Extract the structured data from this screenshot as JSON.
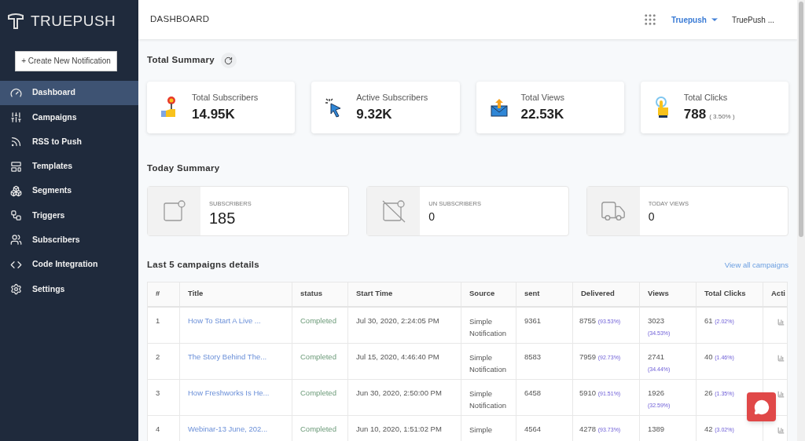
{
  "brand": "TRUEPUSH",
  "create_button": "+ Create New Notification",
  "sidebar": {
    "items": [
      {
        "label": "Dashboard",
        "selected": true
      },
      {
        "label": "Campaigns",
        "selected": false
      },
      {
        "label": "RSS to Push",
        "selected": false
      },
      {
        "label": "Templates",
        "selected": false
      },
      {
        "label": "Segments",
        "selected": false
      },
      {
        "label": "Triggers",
        "selected": false
      },
      {
        "label": "Subscribers",
        "selected": false
      },
      {
        "label": "Code Integration",
        "selected": false
      },
      {
        "label": "Settings",
        "selected": false
      }
    ]
  },
  "header": {
    "title": "DASHBOARD",
    "project": "Truepush",
    "user": "TruePush ..."
  },
  "total_summary": {
    "title": "Total Summary",
    "cards": [
      {
        "label": "Total Subscribers",
        "value": "14.95K"
      },
      {
        "label": "Active Subscribers",
        "value": "9.32K"
      },
      {
        "label": "Total Views",
        "value": "22.53K"
      },
      {
        "label": "Total Clicks",
        "value": "788",
        "note": "( 3.50% )"
      }
    ]
  },
  "today_summary": {
    "title": "Today Summary",
    "cards": [
      {
        "label": "SUBSCRIBERS",
        "value": "185"
      },
      {
        "label": "UN SUBSCRIBERS",
        "value": "0"
      },
      {
        "label": "TODAY VIEWS",
        "value": "0"
      }
    ]
  },
  "campaigns": {
    "title": "Last 5 campaigns details",
    "link": "View all campaigns",
    "columns": [
      "#",
      "Title",
      "status",
      "Start Time",
      "Source",
      "sent",
      "Delivered",
      "Views",
      "Total Clicks",
      "Acti"
    ],
    "rows": [
      {
        "index": "1",
        "title": "How To Start A Live ...",
        "status": "Completed",
        "start_time": "Jul 30, 2020, 2:24:05 PM",
        "source": "Simple Notification",
        "sent": "9361",
        "delivered": "8755",
        "delivered_pct": "(93.53%)",
        "views": "3023",
        "views_pct": "(34.53%)",
        "clicks": "61",
        "clicks_pct": "(2.02%)"
      },
      {
        "index": "2",
        "title": "The Story Behind The...",
        "status": "Completed",
        "start_time": "Jul 15, 2020, 4:46:40 PM",
        "source": "Simple Notification",
        "sent": "8583",
        "delivered": "7959",
        "delivered_pct": "(92.73%)",
        "views": "2741",
        "views_pct": "(34.44%)",
        "clicks": "40",
        "clicks_pct": "(1.46%)"
      },
      {
        "index": "3",
        "title": "How Freshworks Is He...",
        "status": "Completed",
        "start_time": "Jun 30, 2020, 2:50:00 PM",
        "source": "Simple Notification",
        "sent": "6458",
        "delivered": "5910",
        "delivered_pct": "(91.51%)",
        "views": "1926",
        "views_pct": "(32.59%)",
        "clicks": "26",
        "clicks_pct": "(1.35%)"
      },
      {
        "index": "4",
        "title": "Webinar-13 June, 202...",
        "status": "Completed",
        "start_time": "Jun 10, 2020, 1:51:02 PM",
        "source": "Simple",
        "sent": "4564",
        "delivered": "4278",
        "delivered_pct": "(93.73%)",
        "views": "1389",
        "clicks": "42",
        "clicks_pct": "(3.02%)"
      }
    ]
  }
}
